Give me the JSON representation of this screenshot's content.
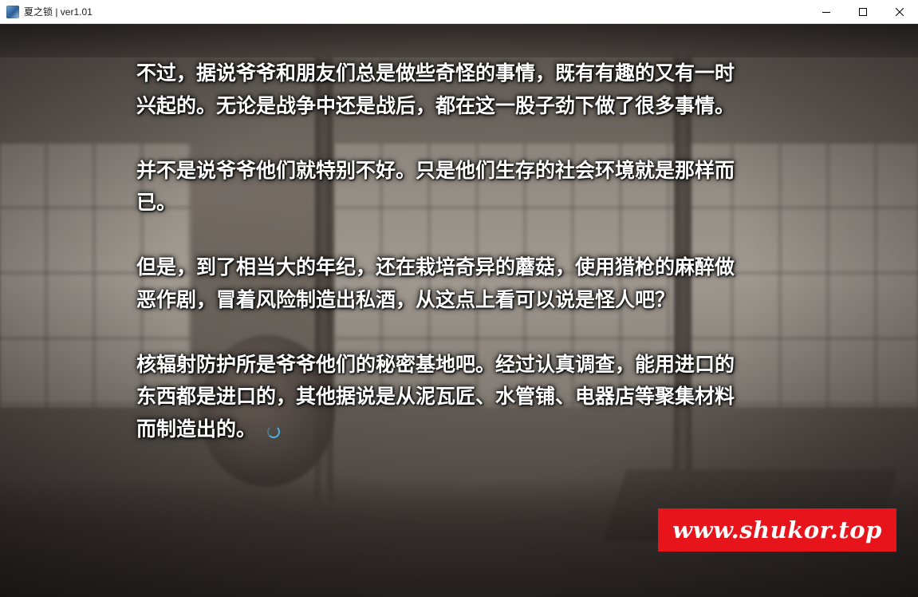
{
  "window": {
    "title": "夏之锁 | ver1.01",
    "icon": "app-icon",
    "controls": [
      "minimize-icon",
      "maximize-icon",
      "close-icon"
    ]
  },
  "message": {
    "paragraphs": [
      "不过，据说爷爷和朋友们总是做些奇怪的事情，既有有趣的又有一时兴起的。无论是战争中还是战后，都在这一股子劲下做了很多事情。",
      "并不是说爷爷他们就特别不好。只是他们生存的社会环境就是那样而已。",
      "但是，到了相当大的年纪，还在栽培奇异的蘑菇，使用猎枪的麻醉做恶作剧，冒着风险制造出私酒，从这点上看可以说是怪人吧？",
      "核辐射防护所是爷爷他们的秘密基地吧。经过认真调查，能用进口的东西都是进口的，其他据说是从泥瓦匠、水管铺、电器店等聚集材料而制造出的。"
    ],
    "wait_indicator": "loading-spinner-icon"
  },
  "watermark": {
    "text": "www.shukor.top",
    "color": "#e8141b"
  },
  "colors": {
    "text": "#ffffff",
    "accent_spinner": "#49b4e6"
  }
}
